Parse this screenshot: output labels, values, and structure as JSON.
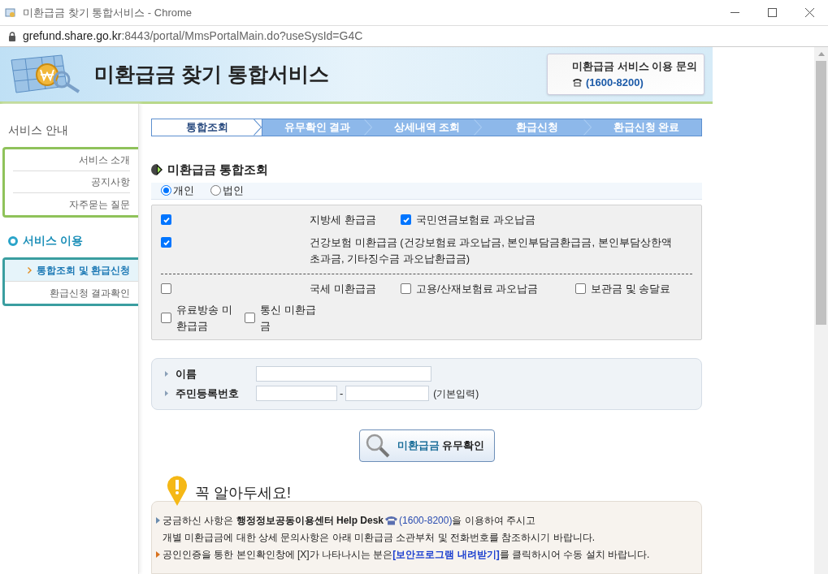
{
  "window": {
    "title": "미환급금 찾기 통합서비스 - Chrome"
  },
  "address_bar": {
    "host": "grefund.share.go.kr",
    "path": ":8443/portal/MmsPortalMain.do?useSysId=G4C"
  },
  "header": {
    "title": "미환급금 찾기 통합서비스",
    "contact_label": "미환급금 서비스 이용 문의",
    "contact_phone": "(1600-8200)"
  },
  "sidebar": {
    "sections": [
      {
        "title": "서비스 안내",
        "kind": "plain",
        "items": [
          {
            "label": "서비스 소개",
            "selected": false
          },
          {
            "label": "공지사항",
            "selected": false
          },
          {
            "label": "자주묻는 질문",
            "selected": false
          }
        ]
      },
      {
        "title": "서비스 이용",
        "kind": "circle",
        "items": [
          {
            "label": "통합조회 및 환급신청",
            "selected": true
          },
          {
            "label": "환급신청 결과확인",
            "selected": false
          }
        ]
      }
    ]
  },
  "steps": [
    {
      "label": "통합조회",
      "selected": true
    },
    {
      "label": "유무확인 결과",
      "selected": false
    },
    {
      "label": "상세내역 조회",
      "selected": false
    },
    {
      "label": "환급신청",
      "selected": false
    },
    {
      "label": "환급신청 완료",
      "selected": false
    }
  ],
  "section_title": "미환급금 통합조회",
  "applicant_types": [
    {
      "label": "개인",
      "selected": true
    },
    {
      "label": "법인",
      "selected": false
    }
  ],
  "refund_blocks": [
    {
      "rows": [
        {
          "kind": "columns",
          "items": [
            {
              "label": "지방세 환급금",
              "checked": true
            },
            {
              "label": "국민연금보험료 과오납금",
              "checked": true
            }
          ]
        },
        {
          "kind": "columns",
          "items": [
            {
              "label": "건강보험 미환급금 (건강보험료 과오납금, 본인부담금환급금, 본인부담상한액 초과금, 기타징수금 과오납환급금)",
              "checked": true
            }
          ]
        }
      ]
    },
    {
      "rows": [
        {
          "kind": "columns",
          "items": [
            {
              "label": "국세 미환급금",
              "checked": false
            },
            {
              "label": "고용/산재보험료 과오납금",
              "checked": false
            },
            {
              "label": "보관금 및 송달료",
              "checked": false
            }
          ]
        },
        {
          "kind": "inline",
          "items": [
            {
              "label": "유료방송 미환급금",
              "checked": false
            },
            {
              "label": "통신 미환급금",
              "checked": false
            }
          ]
        }
      ]
    }
  ],
  "form": {
    "fields": [
      {
        "kind": "single",
        "label": "이름"
      },
      {
        "kind": "split",
        "label": "주민등록번호",
        "separator": "-",
        "note": "(기본입력)"
      }
    ]
  },
  "check_button": {
    "highlight": "미환급금",
    "label": "유무확인"
  },
  "notice": {
    "title": "꼭 알아두세요!",
    "items": [
      {
        "kind": "phone",
        "color": "#6b8cae",
        "before": "궁금하신 사항은 **행정정보공동이용센터 Help Desk** ",
        "link": "(1600-8200)",
        "after": "을 이용하여 주시고",
        "continuation": "개별 미환급금에 대한 상세 문의사항은 아래 미환급금 소관부처 및 전화번호를 참조하시기 바랍니다."
      },
      {
        "kind": "link",
        "color": "#d9731f",
        "before": "공인인증을 통한 본인확인창에 [X]가 나타나시는 분은 ",
        "link": "[보안프로그램 내려받기]",
        "after": "를 클릭하시어 수동 설치 바랍니다."
      }
    ]
  }
}
